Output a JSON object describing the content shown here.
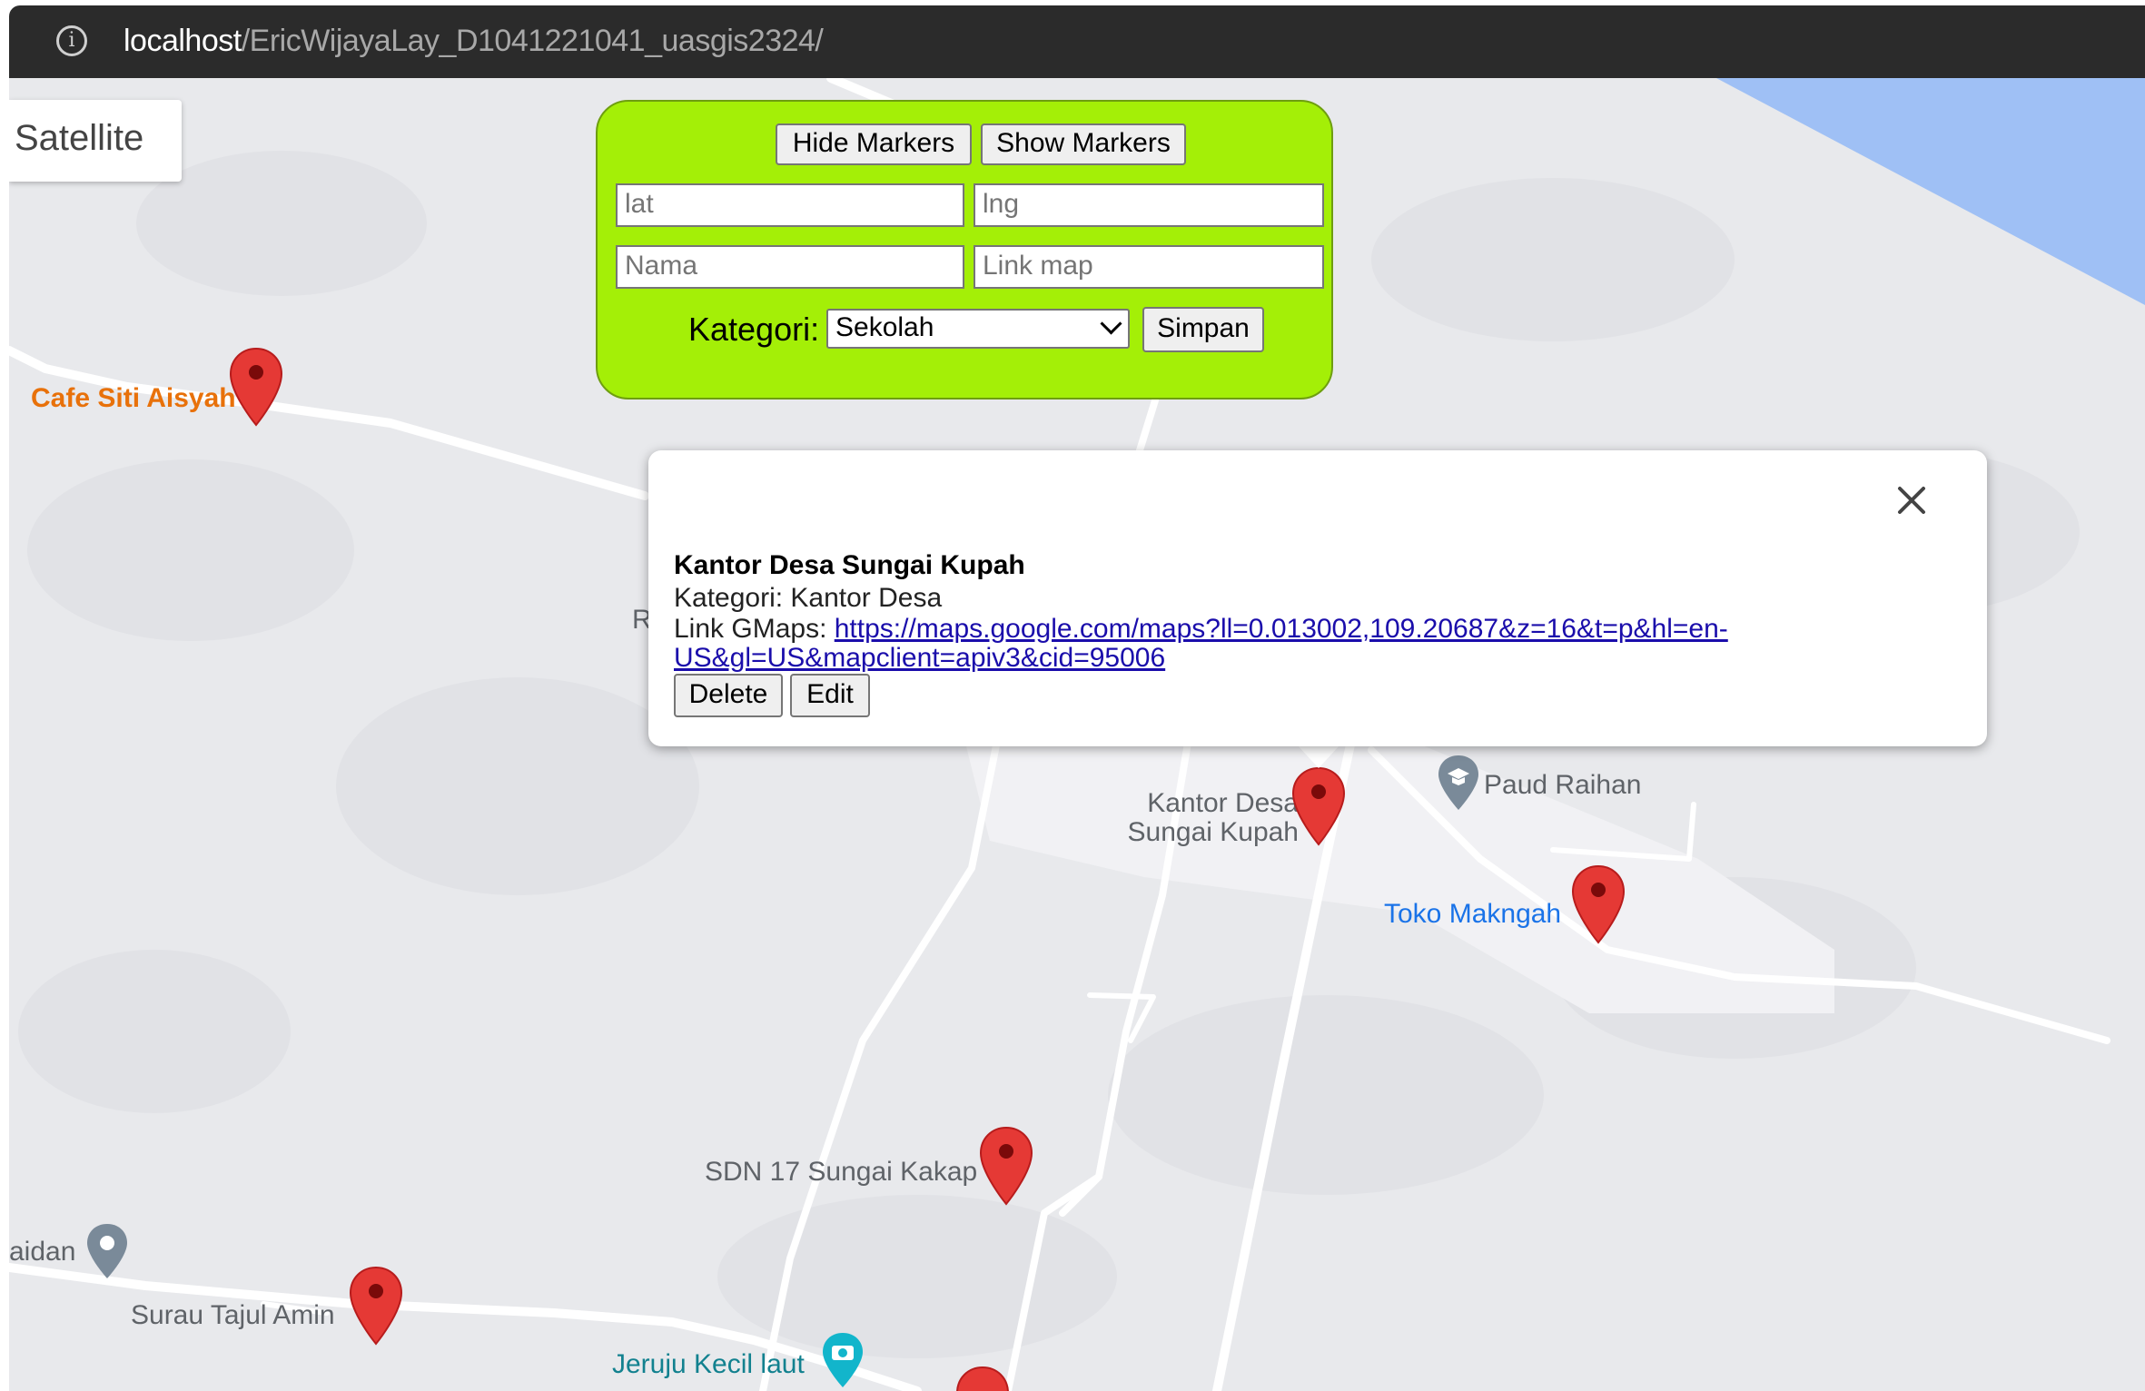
{
  "browser": {
    "url_host": "localhost",
    "url_path": "/EricWijayaLay_D1041221041_uasgis2324/",
    "info_icon": "info-circle-icon"
  },
  "map_controls": {
    "satellite_label": "Satellite"
  },
  "form": {
    "hide_label": "Hide Markers",
    "show_label": "Show Markers",
    "lat_placeholder": "lat",
    "lng_placeholder": "lng",
    "nama_placeholder": "Nama",
    "link_placeholder": "Link map",
    "kategori_label": "Kategori:",
    "kategori_value": "Sekolah",
    "simpan_label": "Simpan",
    "panel_color": "#a4ef07"
  },
  "popup": {
    "title": "Kantor Desa Sungai Kupah",
    "kategori_line": "Kategori: Kantor Desa",
    "link_prefix": "Link GMaps: ",
    "link_text_1": "https://maps.google.com/maps?ll=0.013002,109.20687&z=16&t=p&hl=en-",
    "link_text_2": "US&gl=US&mapclient=apiv3&cid=95006",
    "delete_label": "Delete",
    "edit_label": "Edit"
  },
  "places": {
    "cafe": "Cafe Siti Aisyah",
    "r_partial": "R",
    "kantor_1": "Kantor Desa",
    "kantor_2": "Sungai Kupah",
    "paud": "Paud Raihan",
    "toko": "Toko Makngah",
    "sdn": "SDN 17 Sungai Kakap",
    "aidan": "aidan",
    "surau": "Surau Tajul Amin",
    "jeruju": "Jeruju Kecil laut"
  },
  "colors": {
    "marker": "#e53935",
    "water": "#9fc0f5",
    "map_bg": "#e8e9ec",
    "road": "#ffffff",
    "poi_blue": "#1a73e8",
    "poi_orange": "#e8710a",
    "poi_gray": "#5f6368",
    "poi_teal": "#12b5cb"
  }
}
